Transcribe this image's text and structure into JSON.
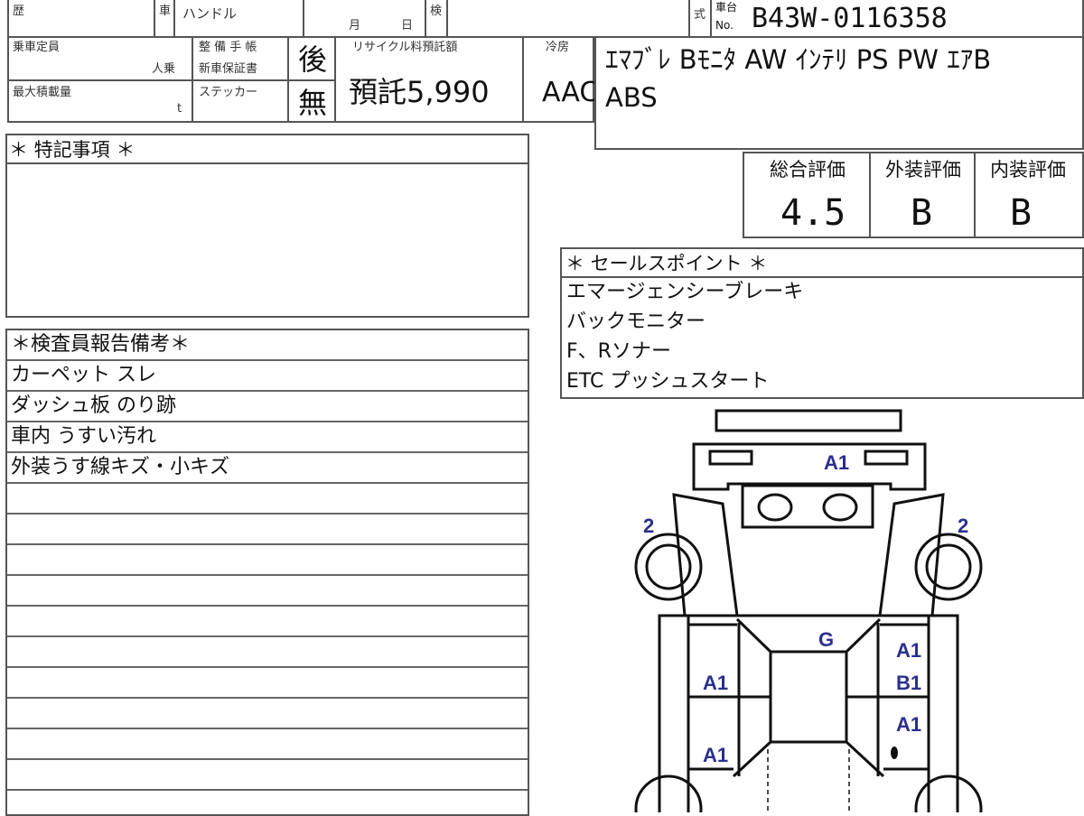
{
  "header": {
    "history_label": "歴",
    "car_label": "車",
    "handle_label": "ハンドル",
    "month_label": "月",
    "day_label": "日",
    "inspection_label": "検",
    "type_label": "式",
    "chassis_label_1": "車台",
    "chassis_label_2": "No.",
    "chassis_no": "B43W-0116358"
  },
  "specs": {
    "capacity_label": "乗車定員",
    "capacity_unit": "人乗",
    "load_label": "最大積載量",
    "load_unit": "t",
    "maintenance_label": "整 備 手 帳",
    "warranty_label": "新車保証書",
    "sticker_label": "ステッカー",
    "maintenance_value": "後",
    "warranty_value": "無",
    "recycle_label": "リサイクル料預託額",
    "recycle_value": "預託5,990",
    "ac_label": "冷房",
    "ac_value": "AAC"
  },
  "equipment": {
    "line1": "ｴﾏﾌﾞﾚ Bﾓﾆﾀ AW ｲﾝﾃﾘ PS PW ｴｱB",
    "line2": "ABS"
  },
  "notes": {
    "title": "＊ 特記事項 ＊"
  },
  "ratings": {
    "overall_label": "総合評価",
    "exterior_label": "外装評価",
    "interior_label": "内装評価",
    "overall_value": "4.5",
    "exterior_value": "B",
    "interior_value": "B"
  },
  "sales_points": {
    "title": "＊ セールスポイント ＊",
    "items": [
      "エマージェンシーブレーキ",
      "バックモニター",
      "F、Rソナー",
      "ETC プッシュスタート"
    ]
  },
  "inspector": {
    "title": "＊検査員報告備考＊",
    "items": [
      "カーペット スレ",
      "ダッシュ板 のり跡",
      "車内 うすい汚れ",
      "外装うす線キズ・小キズ"
    ]
  },
  "diagram_marks": {
    "front": "A1",
    "left_front_wheel": "2",
    "right_front_wheel": "2",
    "roof": "G",
    "right_door_1": "A1",
    "right_door_2": "B1",
    "right_door_3": "A1",
    "left_door_1": "A1",
    "left_door_2": "A1"
  },
  "colors": {
    "mark": "#2b2f8f",
    "border": "#555555"
  }
}
